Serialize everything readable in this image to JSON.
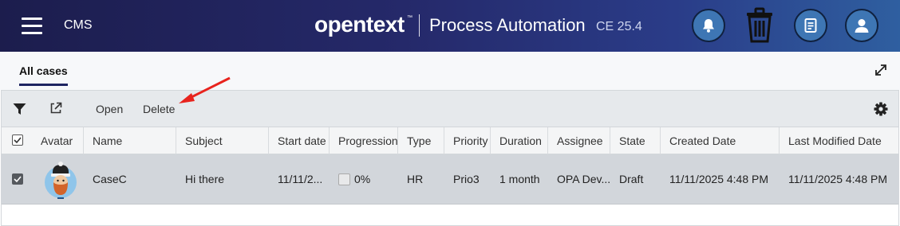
{
  "header": {
    "app_name": "CMS",
    "brand": "opentext",
    "brand_tm": "™",
    "product": "Process Automation",
    "version": "CE 25.4",
    "icons": [
      "menu-icon",
      "bell-icon",
      "trash-icon",
      "document-icon",
      "user-icon"
    ]
  },
  "tabs": [
    {
      "label": "All cases",
      "active": true
    }
  ],
  "toolbar": {
    "open_label": "Open",
    "delete_label": "Delete"
  },
  "table": {
    "columns": [
      "Avatar",
      "Name",
      "Subject",
      "Start date",
      "Progression",
      "Type",
      "Priority",
      "Duration",
      "Assignee",
      "State",
      "Created Date",
      "Last Modified Date"
    ],
    "rows": [
      {
        "selected": true,
        "name": "CaseC",
        "subject": "Hi there",
        "start_date": "11/11/2...",
        "progression": "0%",
        "type": "HR",
        "priority": "Prio3",
        "duration": "1 month",
        "assignee": "OPA Dev...",
        "state": "Draft",
        "created_date": "11/11/2025 4:48 PM",
        "last_modified_date": "11/11/2025 4:48 PM"
      }
    ]
  },
  "colors": {
    "header_dark": "#1c1d4d",
    "header_light": "#2f5fa0",
    "annotation": "#e8231d",
    "selected_row": "#d2d6db"
  }
}
